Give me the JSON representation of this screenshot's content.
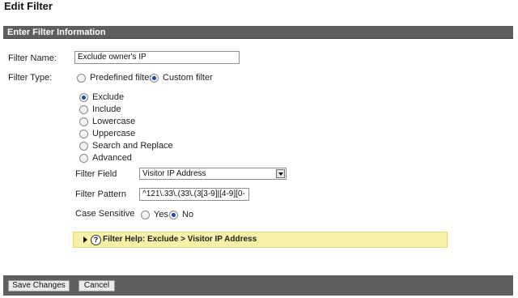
{
  "page": {
    "title": "Edit Filter"
  },
  "section": {
    "header": "Enter Filter Information"
  },
  "filter_name": {
    "label": "Filter Name:",
    "value": "Exclude owner's IP"
  },
  "filter_type": {
    "label": "Filter Type:",
    "options": [
      {
        "label": "Predefined filter",
        "checked": false
      },
      {
        "label": "Custom filter",
        "checked": true
      }
    ]
  },
  "custom_options": [
    {
      "label": "Exclude",
      "checked": true
    },
    {
      "label": "Include",
      "checked": false
    },
    {
      "label": "Lowercase",
      "checked": false
    },
    {
      "label": "Uppercase",
      "checked": false
    },
    {
      "label": "Search and Replace",
      "checked": false
    },
    {
      "label": "Advanced",
      "checked": false
    }
  ],
  "filter_field": {
    "label": "Filter Field",
    "value": "Visitor IP Address"
  },
  "filter_pattern": {
    "label": "Filter Pattern",
    "value": "^121\\.33\\.(33\\.(3[3-9]|[4-9][0-"
  },
  "case_sensitive": {
    "label": "Case Sensitive",
    "options": [
      {
        "label": "Yes",
        "checked": false
      },
      {
        "label": "No",
        "checked": true
      }
    ]
  },
  "help": {
    "icon_glyph": "?",
    "text": "Filter Help: Exclude  >  Visitor IP Address"
  },
  "buttons": {
    "save_label": "Save Changes",
    "cancel_label": "Cancel"
  },
  "colors": {
    "header_bg": "#5e5e5e",
    "help_bg": "#f7f0a8",
    "radio_dot": "#1b4aa8"
  }
}
